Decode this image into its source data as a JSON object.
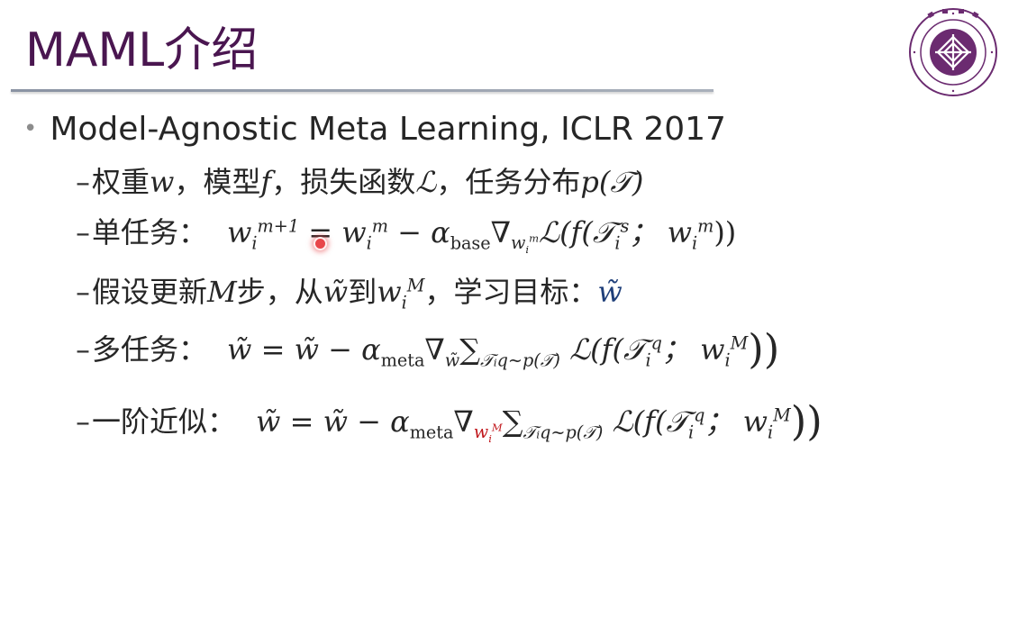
{
  "slide": {
    "title": "MAML介绍",
    "bullet": "Model-Agnostic Meta Learning, ICLR 2017",
    "dash": "–",
    "line1": {
      "t1": "权重",
      "w": "w",
      "t2": "，模型",
      "f": "f",
      "t3": "，损失函数",
      "L": "ℒ",
      "t4": "，任务分布",
      "p": "p(𝒯)"
    },
    "line2": {
      "label": "单任务：",
      "lhs_w": "w",
      "lhs_sub": "i",
      "lhs_sup": "m+1",
      "eq": "=",
      "rhs_w": "w",
      "rhs_sub": "i",
      "rhs_sup": "m",
      "minus": "−",
      "alpha": "α",
      "alpha_sub": "base",
      "nabla": "∇",
      "nabla_w": "w",
      "nabla_wsub": "i",
      "nabla_wsup": "m",
      "loss": "ℒ(f(𝒯",
      "T_sub": "i",
      "T_sup": "s",
      "sep": "； w",
      "w2_sub": "i",
      "w2_sup": "m",
      "close": "))"
    },
    "line3": {
      "t1": "假设更新",
      "M": "M",
      "t2": "步，从",
      "wt": "w̃",
      "t3": "到",
      "wM": "w",
      "wM_sub": "i",
      "wM_sup": "M",
      "t4": "，学习目标：",
      "goal": "w̃"
    },
    "line4": {
      "label": "多任务：",
      "lhs": "w̃",
      "eq": "=",
      "rhs": "w̃",
      "minus": "−",
      "alpha": "α",
      "alpha_sub": "meta",
      "nabla": "∇",
      "nabla_sub": "w̃",
      "sum": "∑",
      "sum_sub": "𝒯ᵢq~p(𝒯)",
      "loss": "ℒ(f(𝒯",
      "T_sub": "i",
      "T_sup": "q",
      "sep": "； w",
      "w_sub": "i",
      "w_sup": "M",
      "close": "))"
    },
    "line5": {
      "label": "一阶近似：",
      "lhs": "w̃",
      "eq": "=",
      "rhs": "w̃",
      "minus": "−",
      "alpha": "α",
      "alpha_sub": "meta",
      "nabla": "∇",
      "nabla_w": "w",
      "nabla_wsub": "i",
      "nabla_wsup": "M",
      "sum": "∑",
      "sum_sub": "𝒯ᵢq~p(𝒯)",
      "loss": "ℒ(f(𝒯",
      "T_sub": "i",
      "T_sup": "q",
      "sep": "； w",
      "w_sub": "i",
      "w_sup": "M",
      "close": "))"
    }
  },
  "colors": {
    "title": "#4a1650",
    "logo": "#6b2b70",
    "goal_blue": "#1f3f7a",
    "highlight_red": "#c0161b",
    "laser": "#e8464a"
  },
  "logo": {
    "icon": "university-seal-icon"
  }
}
